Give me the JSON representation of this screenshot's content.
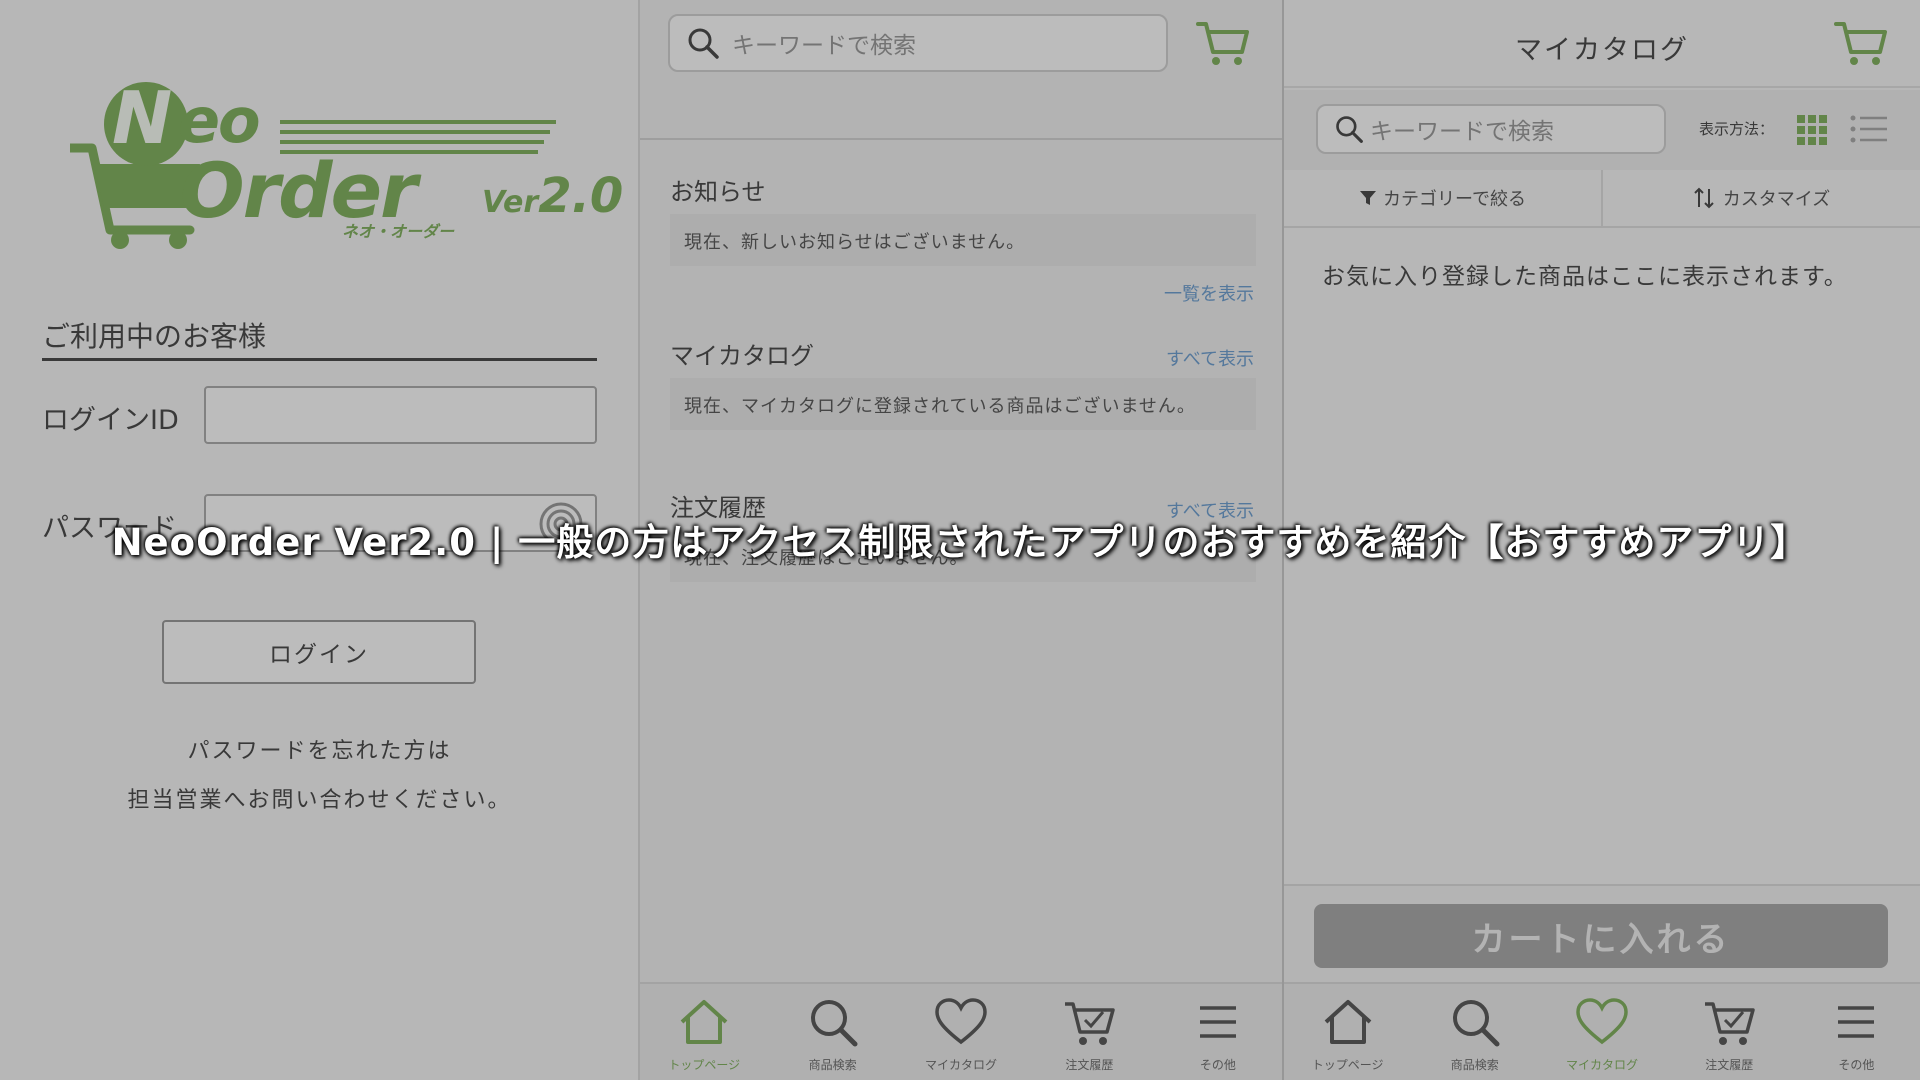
{
  "overlay": {
    "title": "NeoOrder Ver2.0 | 一般の方はアクセス制限されたアプリのおすすめを紹介【おすすめアプリ】"
  },
  "login": {
    "logo": {
      "neo": "Neo",
      "order": "Order",
      "ver_prefix": "Ver",
      "ver_number": "2.0",
      "sub": "ネオ・オーダー"
    },
    "section_title": "ご利用中のお客様",
    "login_id_label": "ログインID",
    "password_label": "パスワード",
    "login_button": "ログイン",
    "note_line1": "パスワードを忘れた方は",
    "note_line2": "担当営業へお問い合わせください。"
  },
  "home": {
    "search_placeholder": "キーワードで検索",
    "news": {
      "title": "お知らせ",
      "message": "現在、新しいお知らせはございません。",
      "link": "一覧を表示"
    },
    "catalog": {
      "title": "マイカタログ",
      "message": "現在、マイカタログに登録されている商品はございません。",
      "link": "すべて表示"
    },
    "history": {
      "title": "注文履歴",
      "message": "現在、注文履歴はございません。",
      "link": "すべて表示"
    },
    "nav": [
      {
        "label": "トップページ",
        "icon": "home-icon"
      },
      {
        "label": "商品検索",
        "icon": "search-icon"
      },
      {
        "label": "マイカタログ",
        "icon": "heart-icon"
      },
      {
        "label": "注文履歴",
        "icon": "cart-check-icon"
      },
      {
        "label": "その他",
        "icon": "menu-icon"
      }
    ],
    "active_nav": "トップページ"
  },
  "catalog": {
    "title": "マイカタログ",
    "search_placeholder": "キーワードで検索",
    "view_label": "表示方法：",
    "filter_label": "カテゴリーで絞る",
    "customize_label": "カスタマイズ",
    "empty_message": "お気に入り登録した商品はここに表示されます。",
    "add_to_cart": "カートに入れる",
    "nav": [
      {
        "label": "トップページ",
        "icon": "home-icon"
      },
      {
        "label": "商品検索",
        "icon": "search-icon"
      },
      {
        "label": "マイカタログ",
        "icon": "heart-icon"
      },
      {
        "label": "注文履歴",
        "icon": "cart-check-icon"
      },
      {
        "label": "その他",
        "icon": "menu-icon"
      }
    ],
    "active_nav": "マイカタログ"
  },
  "colors": {
    "brand_green": "#6fa24a",
    "link_blue": "#5b8fc4",
    "button_gray": "#9a9a9a"
  }
}
